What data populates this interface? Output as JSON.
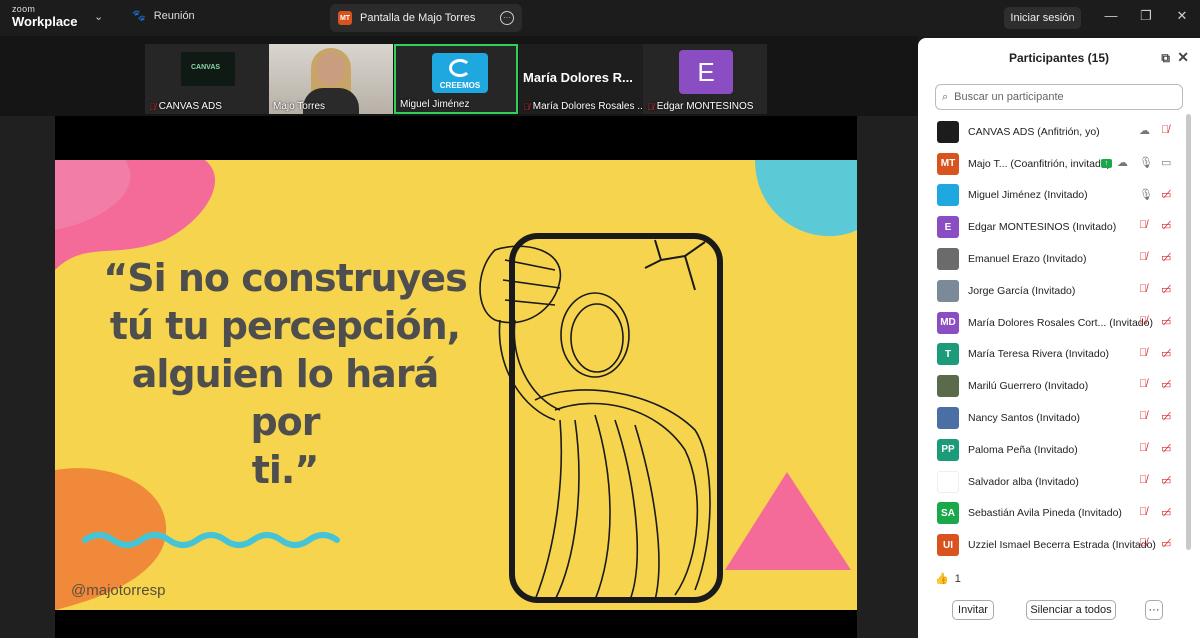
{
  "app": {
    "brand_small": "zoom",
    "brand_big": "Workplace"
  },
  "topbar": {
    "meeting_label": "Reunión",
    "share_badge": "MT",
    "share_title": "Pantalla de Majo Torres",
    "signin": "Iniciar sesión"
  },
  "thumbs": [
    {
      "name": "CANVAS ADS",
      "muted": true,
      "logo_text": "CANVAS"
    },
    {
      "name": "Majo Torres",
      "muted": false
    },
    {
      "name": "Miguel Jiménez",
      "muted": false,
      "logo_text": "CREEMOS",
      "active_speaker": true
    },
    {
      "name": "María Dolores Rosales ...",
      "muted": true,
      "big_label": "María Dolores R..."
    },
    {
      "name": "Edgar MONTESINOS",
      "muted": true,
      "initial": "E"
    }
  ],
  "slide": {
    "quote_lines": [
      "“Si no construyes",
      "tú tu percepción,",
      "alguien lo hará por",
      "ti.”"
    ],
    "handle": "@majotorresp"
  },
  "panel": {
    "title": "Participantes (15)",
    "search_placeholder": "Buscar un participante",
    "participants": [
      {
        "initials": "",
        "color": "#1c1c1c",
        "name": "CANVAS ADS (Anfitrión, yo)",
        "icons": "cloud,mic-muted"
      },
      {
        "initials": "MT",
        "color": "#d9531e",
        "name": "Majo T...  (Coanfitrión, invitado)",
        "icons": "share,cloud,mic,video"
      },
      {
        "initials": "",
        "color": "#1fa7e0",
        "name": "Miguel Jiménez (Invitado)",
        "icons": "mic,video-off"
      },
      {
        "initials": "E",
        "color": "#8b4ec2",
        "name": "Edgar MONTESINOS (Invitado)",
        "icons": "mic-muted,video-off"
      },
      {
        "initials": "",
        "color": "#6b6b6b",
        "name": "Emanuel Erazo (Invitado)",
        "icons": "mic-muted,video-off"
      },
      {
        "initials": "",
        "color": "#7b8a99",
        "name": "Jorge García (Invitado)",
        "icons": "mic-muted,video-off"
      },
      {
        "initials": "MD",
        "color": "#8b4ec2",
        "name": "María Dolores Rosales Cort...  (Invitado)",
        "icons": "mic-muted,video-off"
      },
      {
        "initials": "T",
        "color": "#1b9b7a",
        "name": "María Teresa Rivera (Invitado)",
        "icons": "mic-muted,video-off"
      },
      {
        "initials": "",
        "color": "#5a6b4a",
        "name": "Marilú Guerrero (Invitado)",
        "icons": "mic-muted,video-off"
      },
      {
        "initials": "",
        "color": "#4a6fa5",
        "name": "Nancy Santos (Invitado)",
        "icons": "mic-muted,video-off"
      },
      {
        "initials": "PP",
        "color": "#1b9b7a",
        "name": "Paloma Peña (Invitado)",
        "icons": "mic-muted,video-off"
      },
      {
        "initials": "",
        "color": "#ffffff",
        "name": "Salvador alba (Invitado)",
        "icons": "mic-muted,video-off"
      },
      {
        "initials": "SA",
        "color": "#1aa84b",
        "name": "Sebastián Avila Pineda (Invitado)",
        "icons": "mic-muted,video-off"
      },
      {
        "initials": "UI",
        "color": "#d9531e",
        "name": "Uzziel Ismael Becerra Estrada (Invitado)",
        "icons": "mic-muted,video-off"
      }
    ],
    "reaction_count": "1",
    "invite": "Invitar",
    "mute_all": "Silenciar a todos",
    "more": "···"
  }
}
